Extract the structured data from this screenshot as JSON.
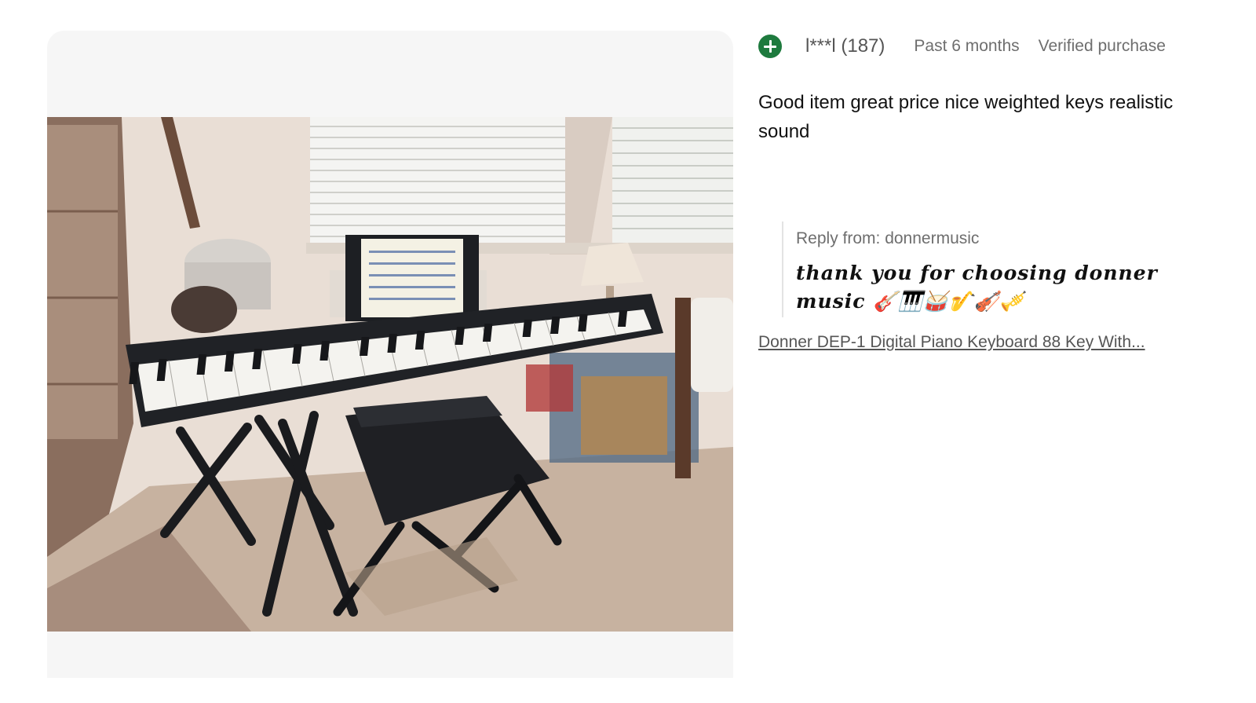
{
  "photo": {
    "alt": "Donner DEP-1 Digital Piano Keyboard"
  },
  "review": {
    "user_icon": "plus-circle-icon",
    "username": "l***l (187)",
    "date": "Past 6 months",
    "verified": "Verified purchase",
    "text": "Good item great price nice weighted keys realistic sound",
    "reply": {
      "from": "Reply from: donnermusic",
      "text": "thank you for choosing donner music 🎸🎹🥁🎷🎻🎺"
    },
    "product_link": "Donner DEP-1 Digital Piano Keyboard 88 Key With..."
  },
  "colors": {
    "accent_green": "#1e7a3e",
    "text_muted": "#6e6e6e",
    "panel_bg": "#f6f6f6"
  }
}
